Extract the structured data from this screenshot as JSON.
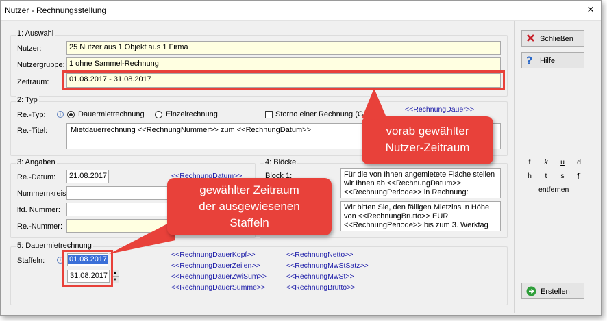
{
  "window": {
    "title": "Nutzer - Rechnungsstellung",
    "close_glyph": "×"
  },
  "section1": {
    "title": "1: Auswahl",
    "nutzer_label": "Nutzer:",
    "nutzer_value": "25 Nutzer aus 1 Objekt aus 1 Firma",
    "gruppe_label": "Nutzergruppe:",
    "gruppe_value": "1 ohne Sammel-Rechnung",
    "zeitraum_label": "Zeitraum:",
    "zeitraum_value": "01.08.2017 - 31.08.2017"
  },
  "section2": {
    "title": "2: Typ",
    "typ_label": "Re.-Typ:",
    "radio1": "Dauermietrechnung",
    "radio2": "Einzelrechnung",
    "storno": "Storno einer Rechnung (Gu",
    "placeholder_top": "<<RechnungDauer>>",
    "titel_label": "Re.-Titel:",
    "titel_value": "Mietdauerrechnung <<RechnungNummer>> zum <<RechnungDatum>>"
  },
  "section3": {
    "title": "3: Angaben",
    "datum_label": "Re.-Datum:",
    "datum_value": "21.08.2017",
    "datum_placeholder": "<<RechnungDatum>>",
    "nummernkreis_label": "Nummernkreis:",
    "lfd_label": "lfd. Nummer:",
    "renummer_label": "Re.-Nummer:"
  },
  "section4": {
    "title": "4: Blöcke",
    "block1_label": "Block 1:",
    "block1_text": [
      "Für die von Ihnen angemietete Fläche stellen",
      "wir Ihnen ab <<RechnungDatum>>",
      "<<RechnungPeriode>> in Rechnung:"
    ],
    "block2_text": [
      "Wir bitten Sie, den fälligen Mietzins in Höhe",
      "von <<RechnungBrutto>> EUR",
      "<<RechnungPeriode>> bis zum 3. Werktag"
    ]
  },
  "section5": {
    "title": "5: Dauermietrechnung",
    "staffeln_label": "Staffeln:",
    "from": "01.08.2017",
    "to": "31.08.2017",
    "placeholders_col1": [
      "<<RechnungDauerKopf>>",
      "<<RechnungDauerZeilen>>",
      "<<RechnungDauerZwiSum>>",
      "<<RechnungDauerSumme>>"
    ],
    "placeholders_col2": [
      "<<RechnungNetto>>",
      "<<RechnungMwStSatz>>",
      "<<RechnungMwSt>>",
      "<<RechnungBrutto>>"
    ]
  },
  "buttons": {
    "schliessen": "Schließen",
    "hilfe": "Hilfe",
    "erstellen": "Erstellen",
    "entfernen": "entfernen",
    "format_row1": [
      "f",
      "k",
      "u",
      "d"
    ],
    "format_row2": [
      "h",
      "t",
      "s",
      "¶"
    ]
  },
  "callouts": {
    "nutzer_zeitraum": [
      "vorab gewählter",
      "Nutzer-Zeitraum"
    ],
    "staffel_zeitraum": [
      "gewählter Zeitraum",
      "der ausgewiesenen",
      "Staffeln"
    ]
  },
  "colors": {
    "accent_red": "#e8413a",
    "field_yellow": "#ffffe1",
    "placeholder_blue": "#1a1aa8"
  }
}
